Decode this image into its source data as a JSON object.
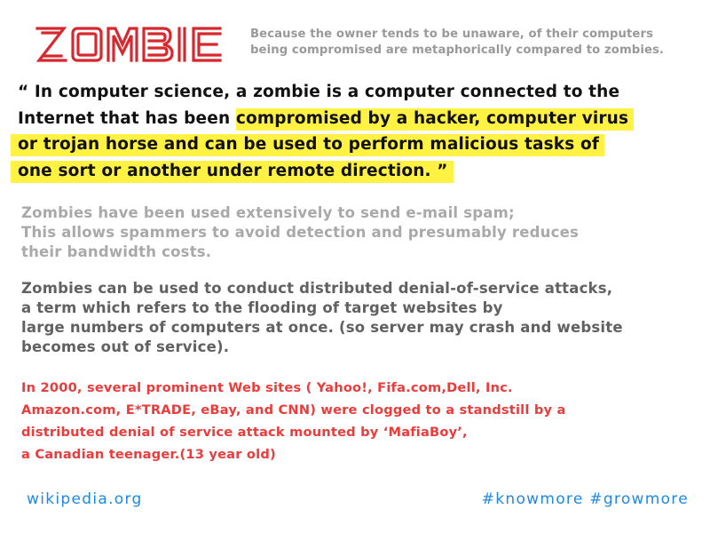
{
  "header": {
    "logo_text": "ZOMBIE",
    "tagline_lines": [
      "Because the owner tends to be unaware, of their computers",
      "being compromised are metaphorically compared to zombies."
    ]
  },
  "quote": {
    "line1": "“ In computer science, a zombie is a computer connected to the",
    "line2_plain": "Internet that has been ",
    "line2_highlight": "compromised by a hacker, computer virus",
    "line3_highlight": "or trojan horse and can be used to perform malicious tasks of",
    "line4_highlight": "one sort or another under remote direction. ”"
  },
  "spam_paragraph": [
    "Zombies have been used extensively to send e-mail spam;",
    "This allows spammers to avoid detection and presumably reduces",
    "their bandwidth costs."
  ],
  "ddos_paragraph": [
    "Zombies can be used to conduct distributed denial-of-service attacks,",
    "a term which refers to the flooding of target websites by",
    "large numbers of computers at once. (so server may crash and website",
    "becomes out of service)."
  ],
  "history_paragraph": [
    "In 2000, several prominent Web sites ( Yahoo!, Fifa.com,Dell, Inc.",
    "Amazon.com, E*TRADE, eBay, and CNN) were clogged to a standstill by a",
    "distributed denial of service attack mounted by ‘MafiaBoy’,",
    "a Canadian teenager.(13 year old)"
  ],
  "footer": {
    "source": "wikipedia.org",
    "hashtags": "#knowmore #growmore"
  },
  "colors": {
    "logo_red": "#d7282f",
    "highlight": "#fff242",
    "link_blue": "#1e88e5",
    "history_red": "#ef3a3a"
  }
}
